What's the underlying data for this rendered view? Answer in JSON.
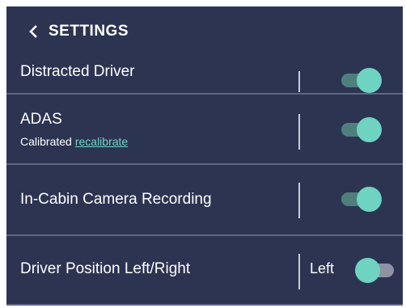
{
  "header": {
    "title": "SETTINGS",
    "back_icon": "chevron-left-icon"
  },
  "rows": [
    {
      "id": "distracted-driver",
      "label": "Distracted Driver",
      "toggle_on": true
    },
    {
      "id": "adas",
      "label": "ADAS",
      "status": "Calibrated",
      "link": "recalibrate",
      "toggle_on": true
    },
    {
      "id": "in-cabin",
      "label": "In-Cabin Camera Recording",
      "toggle_on": true
    },
    {
      "id": "driver-position",
      "label": "Driver Position Left/Right",
      "value": "Left",
      "toggle_on": false
    }
  ],
  "colors": {
    "background": "#2c3452",
    "accent": "#6fd3c1",
    "divider": "#5e6683",
    "toggle_track_on": "#4f7f7d",
    "toggle_track_off": "#8e93a4"
  }
}
